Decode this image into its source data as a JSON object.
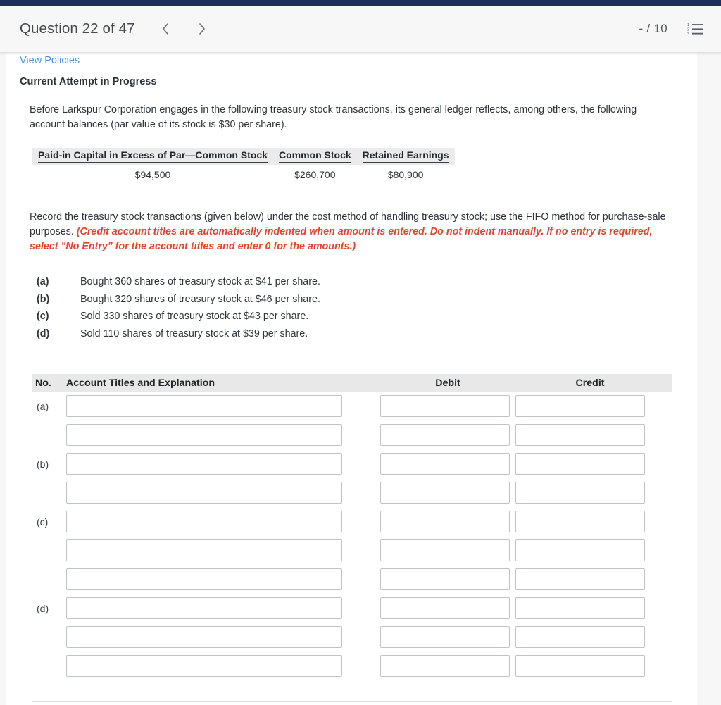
{
  "theme": {
    "topbar_color": "#1d2f52",
    "link_color": "#4a90d9",
    "accent_red": "#e8412c",
    "header_bg": "#f7f7f7",
    "table_header_bg": "#e8e8e8"
  },
  "header": {
    "title": "Question 22 of 47",
    "prev_icon": "chevron-left-icon",
    "next_icon": "chevron-right-icon",
    "score": "- / 10",
    "list_icon": "numbered-list-icon"
  },
  "subheader": {
    "view_policies": "View Policies",
    "attempt_status": "Current Attempt in Progress"
  },
  "problem": {
    "intro": "Before Larkspur Corporation engages in the following treasury stock transactions, its general ledger reflects, among others, the following account balances (par value of its stock is $30 per share).",
    "balances": {
      "headers": [
        "Paid-in Capital in Excess of Par—Common Stock",
        "Common Stock",
        "Retained Earnings"
      ],
      "values": [
        "$94,500",
        "$260,700",
        "$80,900"
      ]
    },
    "record_text": "Record the treasury stock transactions (given below) under the cost method of handling treasury stock; use the FIFO method for purchase-sale purposes. ",
    "record_note": "(Credit account titles are automatically indented when amount is entered. Do not indent manually. If no entry is required, select \"No Entry\" for the account titles and enter 0 for the amounts.)",
    "transactions": [
      {
        "letter": "(a)",
        "text": "Bought 360 shares of treasury stock at $41 per share."
      },
      {
        "letter": "(b)",
        "text": "Bought 320 shares of treasury stock at $46 per share."
      },
      {
        "letter": "(c)",
        "text": "Sold 330 shares of treasury stock at $43 per share."
      },
      {
        "letter": "(d)",
        "text": "Sold 110 shares of treasury stock at $39 per share."
      }
    ]
  },
  "journal": {
    "columns": {
      "no": "No.",
      "account": "Account Titles and Explanation",
      "debit": "Debit",
      "credit": "Credit"
    },
    "rows": [
      {
        "no": "(a)",
        "account": "",
        "debit": "",
        "credit": ""
      },
      {
        "no": "",
        "account": "",
        "debit": "",
        "credit": ""
      },
      {
        "no": "(b)",
        "account": "",
        "debit": "",
        "credit": ""
      },
      {
        "no": "",
        "account": "",
        "debit": "",
        "credit": ""
      },
      {
        "no": "(c)",
        "account": "",
        "debit": "",
        "credit": ""
      },
      {
        "no": "",
        "account": "",
        "debit": "",
        "credit": ""
      },
      {
        "no": "",
        "account": "",
        "debit": "",
        "credit": ""
      },
      {
        "no": "(d)",
        "account": "",
        "debit": "",
        "credit": ""
      },
      {
        "no": "",
        "account": "",
        "debit": "",
        "credit": ""
      },
      {
        "no": "",
        "account": "",
        "debit": "",
        "credit": ""
      }
    ]
  }
}
